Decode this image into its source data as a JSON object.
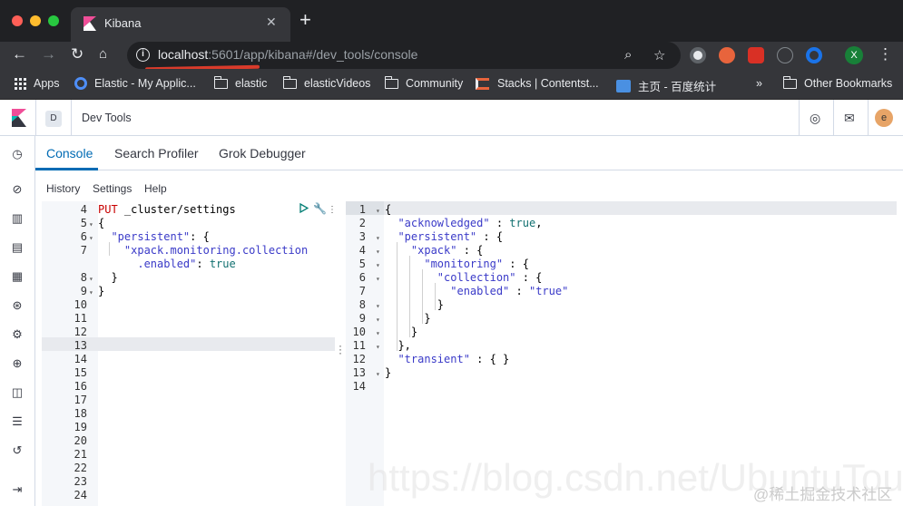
{
  "browser": {
    "tab_title": "Kibana",
    "tab_close": "✕",
    "new_tab": "+",
    "url_host": "localhost",
    "url_rest": ":5601/app/kibana#/dev_tools/console",
    "bookmarks": [
      {
        "label": "Apps",
        "icon": "apps-grid"
      },
      {
        "label": "Elastic - My Applic...",
        "icon": "elastic-logo"
      },
      {
        "label": "elastic",
        "icon": "folder-icon"
      },
      {
        "label": "elasticVideos",
        "icon": "folder-icon"
      },
      {
        "label": "Community",
        "icon": "folder-icon"
      },
      {
        "label": "Stacks | Contentst...",
        "icon": "stacks-icon"
      },
      {
        "label": "主页 - 百度统计",
        "icon": "chart-icon"
      },
      {
        "label": "»",
        "icon": ""
      },
      {
        "label": "Other Bookmarks",
        "icon": "folder-icon"
      }
    ],
    "profile_letter": "X"
  },
  "kibana": {
    "space_letter": "D",
    "app_title": "Dev Tools",
    "user_letter": "e",
    "tabs": [
      "Console",
      "Search Profiler",
      "Grok Debugger"
    ],
    "menu": [
      "History",
      "Settings",
      "Help"
    ]
  },
  "editor_lines": [
    {
      "n": "4",
      "fold": "",
      "code": [
        [
          "kw",
          "PUT "
        ],
        [
          "pun",
          "_cluster/settings"
        ]
      ]
    },
    {
      "n": "5",
      "fold": "▾",
      "code": [
        [
          "pun",
          "{"
        ]
      ]
    },
    {
      "n": "6",
      "fold": "▾",
      "code": [
        [
          "pun",
          "  "
        ],
        [
          "str",
          "\"persistent\""
        ],
        [
          "pun",
          ": {"
        ]
      ]
    },
    {
      "n": "7",
      "fold": "",
      "code": [
        [
          "pun",
          "    "
        ],
        [
          "str",
          "\"xpack.monitoring.collection"
        ]
      ]
    },
    {
      "n": "",
      "fold": "",
      "code": [
        [
          "str",
          "      .enabled\""
        ],
        [
          "pun",
          ": "
        ],
        [
          "val",
          "true"
        ]
      ]
    },
    {
      "n": "8",
      "fold": "▾",
      "code": [
        [
          "pun",
          "  }"
        ]
      ]
    },
    {
      "n": "9",
      "fold": "▾",
      "code": [
        [
          "pun",
          "}"
        ]
      ]
    },
    {
      "n": "10",
      "fold": "",
      "code": []
    },
    {
      "n": "11",
      "fold": "",
      "code": []
    },
    {
      "n": "12",
      "fold": "",
      "code": []
    },
    {
      "n": "13",
      "fold": "",
      "code": []
    },
    {
      "n": "14",
      "fold": "",
      "code": []
    },
    {
      "n": "15",
      "fold": "",
      "code": []
    },
    {
      "n": "16",
      "fold": "",
      "code": []
    },
    {
      "n": "17",
      "fold": "",
      "code": []
    },
    {
      "n": "18",
      "fold": "",
      "code": []
    },
    {
      "n": "19",
      "fold": "",
      "code": []
    },
    {
      "n": "20",
      "fold": "",
      "code": []
    },
    {
      "n": "21",
      "fold": "",
      "code": []
    },
    {
      "n": "22",
      "fold": "",
      "code": []
    },
    {
      "n": "23",
      "fold": "",
      "code": []
    },
    {
      "n": "24",
      "fold": "",
      "code": []
    }
  ],
  "output_lines": [
    {
      "n": "1",
      "fold": "▾",
      "code": [
        [
          "pun",
          "{"
        ]
      ]
    },
    {
      "n": "2",
      "fold": "",
      "code": [
        [
          "pun",
          "  "
        ],
        [
          "str",
          "\"acknowledged\""
        ],
        [
          "pun",
          " : "
        ],
        [
          "val",
          "true"
        ],
        [
          "pun",
          ","
        ]
      ]
    },
    {
      "n": "3",
      "fold": "▾",
      "code": [
        [
          "pun",
          "  "
        ],
        [
          "str",
          "\"persistent\""
        ],
        [
          "pun",
          " : {"
        ]
      ]
    },
    {
      "n": "4",
      "fold": "▾",
      "code": [
        [
          "pun",
          "    "
        ],
        [
          "str",
          "\"xpack\""
        ],
        [
          "pun",
          " : {"
        ]
      ]
    },
    {
      "n": "5",
      "fold": "▾",
      "code": [
        [
          "pun",
          "      "
        ],
        [
          "str",
          "\"monitoring\""
        ],
        [
          "pun",
          " : {"
        ]
      ]
    },
    {
      "n": "6",
      "fold": "▾",
      "code": [
        [
          "pun",
          "        "
        ],
        [
          "str",
          "\"collection\""
        ],
        [
          "pun",
          " : {"
        ]
      ]
    },
    {
      "n": "7",
      "fold": "",
      "code": [
        [
          "pun",
          "          "
        ],
        [
          "str",
          "\"enabled\""
        ],
        [
          "pun",
          " : "
        ],
        [
          "str",
          "\"true\""
        ]
      ]
    },
    {
      "n": "8",
      "fold": "▾",
      "code": [
        [
          "pun",
          "        }"
        ]
      ]
    },
    {
      "n": "9",
      "fold": "▾",
      "code": [
        [
          "pun",
          "      }"
        ]
      ]
    },
    {
      "n": "10",
      "fold": "▾",
      "code": [
        [
          "pun",
          "    }"
        ]
      ]
    },
    {
      "n": "11",
      "fold": "▾",
      "code": [
        [
          "pun",
          "  },"
        ]
      ]
    },
    {
      "n": "12",
      "fold": "",
      "code": [
        [
          "pun",
          "  "
        ],
        [
          "str",
          "\"transient\""
        ],
        [
          "pun",
          " : { }"
        ]
      ]
    },
    {
      "n": "13",
      "fold": "▾",
      "code": [
        [
          "pun",
          "}"
        ]
      ]
    },
    {
      "n": "14",
      "fold": "",
      "code": []
    }
  ],
  "watermark": "https://blog.csdn.net/UbuntuTouch",
  "watermark_cn": "@稀土掘金技术社区",
  "colors": {
    "accent": "#006bb4",
    "chrome_dark": "#202124",
    "string": "#3a3ac8",
    "keyword": "#c80000"
  }
}
